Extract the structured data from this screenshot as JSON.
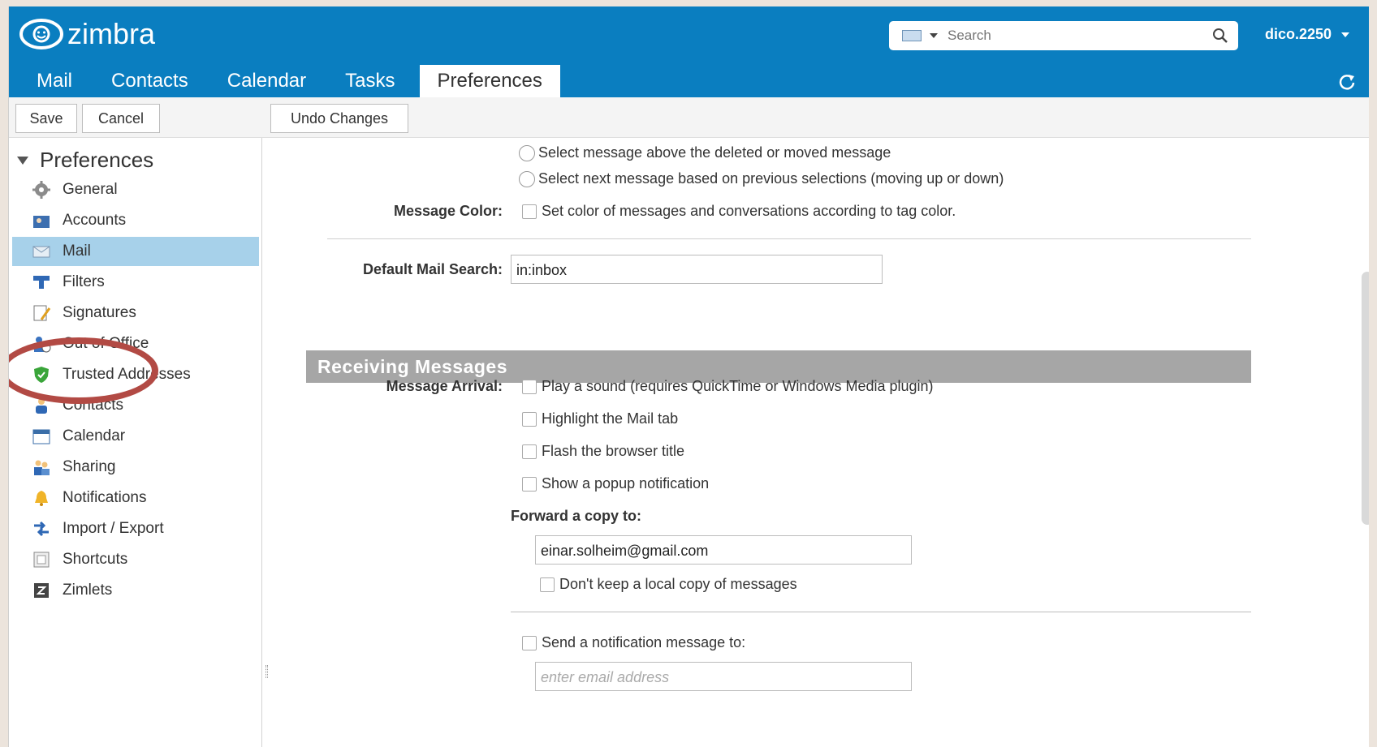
{
  "brand": {
    "name": "zimbra"
  },
  "search": {
    "placeholder": "Search"
  },
  "user": {
    "name": "dico.2250"
  },
  "tabs": [
    "Mail",
    "Contacts",
    "Calendar",
    "Tasks",
    "Preferences"
  ],
  "toolbar": {
    "save": "Save",
    "cancel": "Cancel",
    "undo": "Undo Changes"
  },
  "sidebar": {
    "title": "Preferences",
    "items": [
      {
        "label": "General",
        "icon": "gear-icon"
      },
      {
        "label": "Accounts",
        "icon": "accounts-icon"
      },
      {
        "label": "Mail",
        "icon": "mail-icon"
      },
      {
        "label": "Filters",
        "icon": "filters-icon"
      },
      {
        "label": "Signatures",
        "icon": "signature-icon"
      },
      {
        "label": "Out of Office",
        "icon": "out-of-office-icon"
      },
      {
        "label": "Trusted Addresses",
        "icon": "shield-icon"
      },
      {
        "label": "Contacts",
        "icon": "contacts-icon"
      },
      {
        "label": "Calendar",
        "icon": "calendar-icon"
      },
      {
        "label": "Sharing",
        "icon": "sharing-icon"
      },
      {
        "label": "Notifications",
        "icon": "bell-icon"
      },
      {
        "label": "Import / Export",
        "icon": "import-export-icon"
      },
      {
        "label": "Shortcuts",
        "icon": "keyboard-icon"
      },
      {
        "label": "Zimlets",
        "icon": "zimlets-icon"
      }
    ]
  },
  "main": {
    "radio1": "Select message above the deleted or moved message",
    "radio2": "Select next message based on previous selections (moving up or down)",
    "message_color_label": "Message Color:",
    "message_color_option": "Set color of messages and conversations according to tag color.",
    "default_search_label": "Default Mail Search:",
    "default_search_value": "in:inbox",
    "section_title": "Receiving Messages",
    "arrival_label": "Message Arrival:",
    "arrival_options": [
      "Play a sound (requires QuickTime or Windows Media plugin)",
      "Highlight the Mail tab",
      "Flash the browser title",
      "Show a popup notification"
    ],
    "forward_label": "Forward a copy to:",
    "forward_value": "einar.solheim@gmail.com",
    "dont_keep_copy": "Don't keep a local copy of messages",
    "send_notification": "Send a notification message to:",
    "notification_placeholder": "enter email address"
  },
  "colors": {
    "brand_blue": "#0a7ec0",
    "selected_row": "#a7d1ea",
    "section_bar": "#a6a6a6",
    "annotation_ring": "#b24a44"
  }
}
